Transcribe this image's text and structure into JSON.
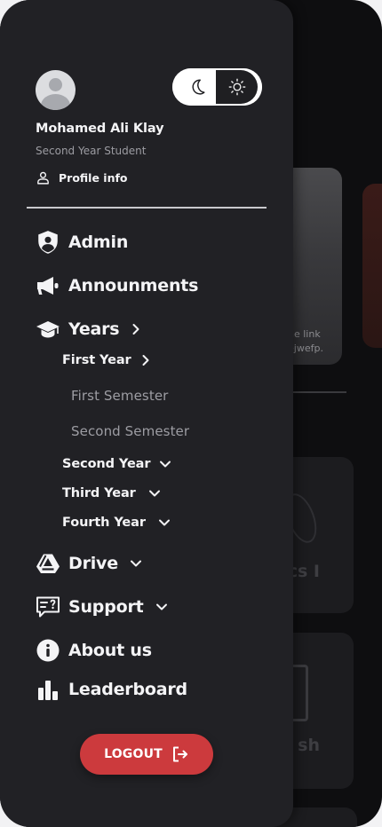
{
  "background": {
    "hero_text": "he link\nejwefp.",
    "card_labels": [
      "cs I",
      "sh"
    ]
  },
  "drawer": {
    "user": {
      "name": "Mohamed Ali Klay",
      "role": "Second Year Student",
      "profile_label": "Profile info"
    },
    "theme_toggle": {
      "options": [
        "moon-icon",
        "sun-icon"
      ],
      "selected": "sun-icon"
    },
    "nav": {
      "admin": "Admin",
      "announcements": "Announments",
      "years": "Years",
      "first_year": "First Year",
      "first_semester": "First Semester",
      "second_semester": "Second Semester",
      "second_year": "Second Year",
      "third_year": "Third Year",
      "fourth_year": "Fourth Year",
      "drive": "Drive",
      "support": "Support",
      "about": "About us",
      "leaderboard": "Leaderboard"
    },
    "logout_label": "LOGOUT"
  },
  "colors": {
    "drawer_bg": "#212125",
    "logout": "#cc3a3d",
    "text_primary": "#f4f4f6",
    "text_muted": "#9d9da3"
  }
}
